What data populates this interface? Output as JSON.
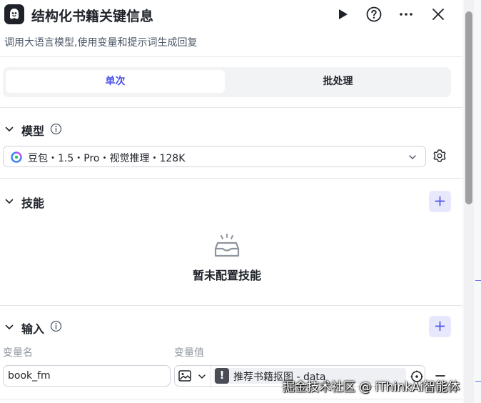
{
  "header": {
    "title": "结构化书籍关键信息",
    "subtitle": "调用大语言模型,使用变量和提示词生成回复"
  },
  "tabs": [
    {
      "label": "单次",
      "active": true
    },
    {
      "label": "批处理",
      "active": false
    }
  ],
  "model_section": {
    "title": "模型",
    "selected_model": "豆包・1.5・Pro・视觉推理・128K"
  },
  "skills_section": {
    "title": "技能",
    "empty_text": "暂未配置技能"
  },
  "input_section": {
    "title": "输入",
    "col_name": "变量名",
    "col_value": "变量值",
    "rows": [
      {
        "name": "book_fm",
        "value": "推荐书籍抠图 - data",
        "badge": "!"
      }
    ]
  },
  "watermark": "掘金技术社区 @ iThinkAi智能体",
  "colors": {
    "accent": "#4d53e8",
    "accent_bg": "#e7e8fb",
    "text": "#1f2329",
    "muted": "#8f959e"
  }
}
